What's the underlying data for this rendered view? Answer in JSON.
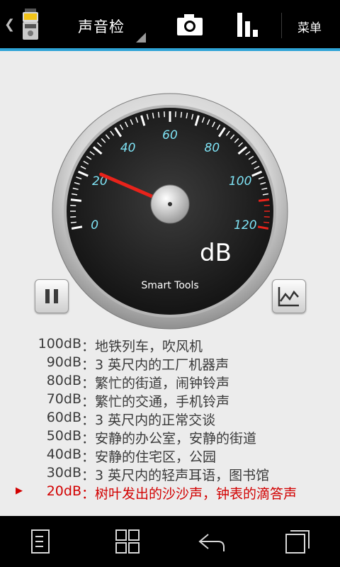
{
  "action_bar": {
    "title": "声音检",
    "menu_label": "菜单",
    "icons": [
      "back-chevron-icon",
      "sound-meter-app-icon",
      "camera-icon",
      "bar-chart-icon"
    ]
  },
  "gauge": {
    "unit": "dB",
    "brand": "Smart Tools",
    "tick_labels": [
      "0",
      "20",
      "40",
      "60",
      "80",
      "100",
      "120"
    ],
    "min": 0,
    "max": 120,
    "value": 20,
    "needle_color": "#e8231b",
    "label_color": "#7fe3f5"
  },
  "buttons": {
    "pause_icon": "pause-icon",
    "graph_icon": "line-graph-icon"
  },
  "reference": [
    {
      "db": "100dB",
      "desc": "：地铁列车，吹风机",
      "active": false
    },
    {
      "db": "90dB",
      "desc": "：3 英尺内的工厂机器声",
      "active": false
    },
    {
      "db": "80dB",
      "desc": "：繁忙的街道，闹钟铃声",
      "active": false
    },
    {
      "db": "70dB",
      "desc": "：繁忙的交通，手机铃声",
      "active": false
    },
    {
      "db": "60dB",
      "desc": "：3 英尺内的正常交谈",
      "active": false
    },
    {
      "db": "50dB",
      "desc": "：安静的办公室，安静的街道",
      "active": false
    },
    {
      "db": "40dB",
      "desc": "：安静的住宅区，公园",
      "active": false
    },
    {
      "db": "30dB",
      "desc": "：3 英尺内的轻声耳语，图书馆",
      "active": false
    },
    {
      "db": "20dB",
      "desc": "：树叶发出的沙沙声，钟表的滴答声",
      "active": true
    }
  ],
  "active_color": "#d20000",
  "accent_color": "#2ea3d6",
  "nav_bar": {
    "icons": [
      "recent-document-icon",
      "grid-icon",
      "back-arrow-icon",
      "recent-apps-icon"
    ]
  }
}
